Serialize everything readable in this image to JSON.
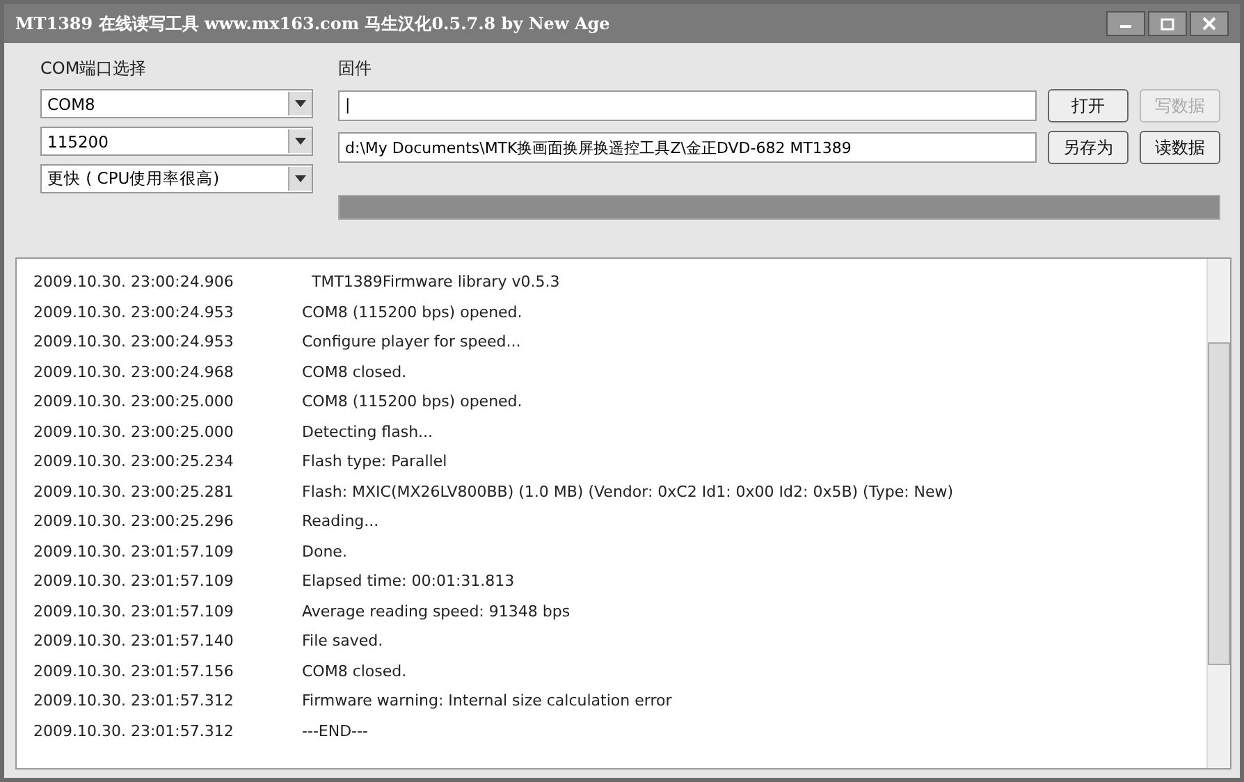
{
  "window": {
    "title": "MT1389 在线读写工具 www.mx163.com 马生汉化0.5.7.8 by New Age"
  },
  "port_label": "COM端口选择",
  "dropdowns": [
    {
      "value": "COM8"
    },
    {
      "value": "115200"
    },
    {
      "value": "更快 ( CPU使用率很高)"
    }
  ],
  "firmware_label": "固件",
  "firmware_field": {
    "value": "|"
  },
  "path_field": {
    "value": "d:\\My Documents\\MTK换画面换屏换遥控工具Z\\金正DVD-682 MT1389"
  },
  "buttons": [
    {
      "label": "打开",
      "disabled": false
    },
    {
      "label": "写数据",
      "disabled": true
    },
    {
      "label": "另存为",
      "disabled": false
    },
    {
      "label": "读数据",
      "disabled": false
    }
  ],
  "progress": {
    "level": 1
  },
  "log": [
    {
      "time": "2009.10.30. 23:00:24.906",
      "message": "  TMT1389Firmware library v0.5.3"
    },
    {
      "time": "2009.10.30. 23:00:24.953",
      "message": "COM8 (115200 bps) opened."
    },
    {
      "time": "2009.10.30. 23:00:24.953",
      "message": "Configure player for speed..."
    },
    {
      "time": "2009.10.30. 23:00:24.968",
      "message": "COM8 closed."
    },
    {
      "time": "2009.10.30. 23:00:25.000",
      "message": "COM8 (115200 bps) opened."
    },
    {
      "time": "2009.10.30. 23:00:25.000",
      "message": "Detecting flash..."
    },
    {
      "time": "2009.10.30. 23:00:25.234",
      "message": "Flash type: Parallel"
    },
    {
      "time": "2009.10.30. 23:00:25.281",
      "message": "Flash: MXIC(MX26LV800BB) (1.0 MB) (Vendor: 0xC2 Id1: 0x00 Id2: 0x5B) (Type: New)"
    },
    {
      "time": "2009.10.30. 23:00:25.296",
      "message": "Reading..."
    },
    {
      "time": "2009.10.30. 23:01:57.109",
      "message": "Done."
    },
    {
      "time": "2009.10.30. 23:01:57.109",
      "message": "Elapsed time: 00:01:31.813"
    },
    {
      "time": "2009.10.30. 23:01:57.109",
      "message": "Average reading speed: 91348 bps"
    },
    {
      "time": "2009.10.30. 23:01:57.140",
      "message": "File saved."
    },
    {
      "time": "2009.10.30. 23:01:57.156",
      "message": "COM8 closed."
    },
    {
      "time": "2009.10.30. 23:01:57.312",
      "message": "Firmware warning: Internal size calculation error"
    },
    {
      "time": "2009.10.30. 23:01:57.312",
      "message": "---END---"
    }
  ]
}
